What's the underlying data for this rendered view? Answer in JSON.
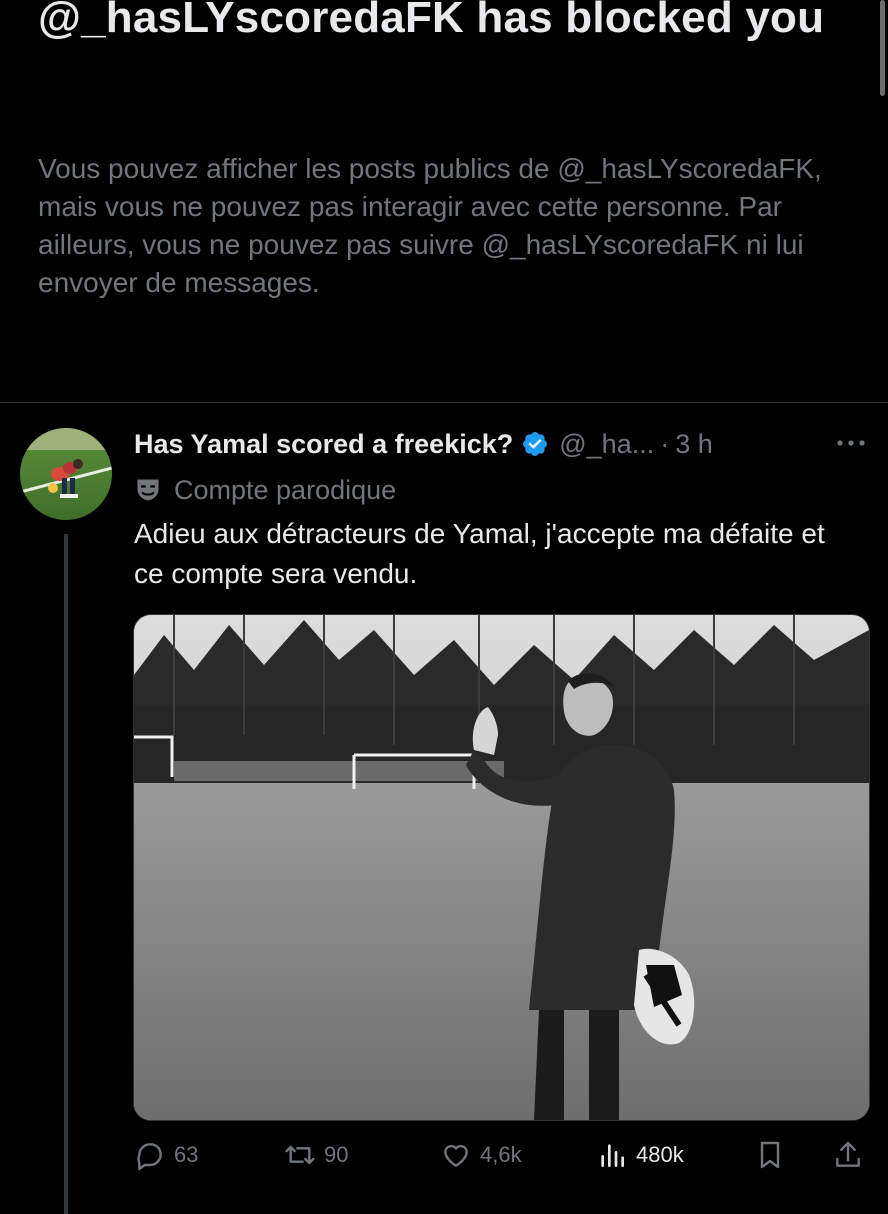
{
  "blocked_notice": {
    "title": "@_hasLYscoredaFK has blocked you",
    "description": "Vous pouvez afficher les posts publics de @_hasLYscoredaFK, mais vous ne pouvez pas interagir avec cette personne. Par ailleurs, vous ne pouvez pas suivre @_hasLYscoredaFK ni lui envoyer de messages."
  },
  "post": {
    "display_name": "Has Yamal scored a freekick?",
    "handle": "@_ha...",
    "separator": "·",
    "time": "3 h",
    "label": "Compte parodique",
    "text": "Adieu aux détracteurs de Yamal, j'accepte ma défaite et ce compte sera vendu.",
    "verified_color": "#1d9bf0",
    "stats": {
      "replies": "63",
      "reposts": "90",
      "likes": "4,6k",
      "views": "480k"
    }
  },
  "icons": {
    "more": "more-horizontal-icon",
    "verified": "verified-badge-icon",
    "parody": "theater-mask-icon",
    "reply": "reply-bubble-icon",
    "repost": "repost-icon",
    "like": "heart-icon",
    "views": "analytics-bars-icon",
    "bookmark": "bookmark-icon",
    "share": "share-icon"
  },
  "theme": {
    "background": "#000000",
    "primary_text": "#e7e9ea",
    "secondary_text": "#71767b",
    "divider": "#2f3336"
  }
}
